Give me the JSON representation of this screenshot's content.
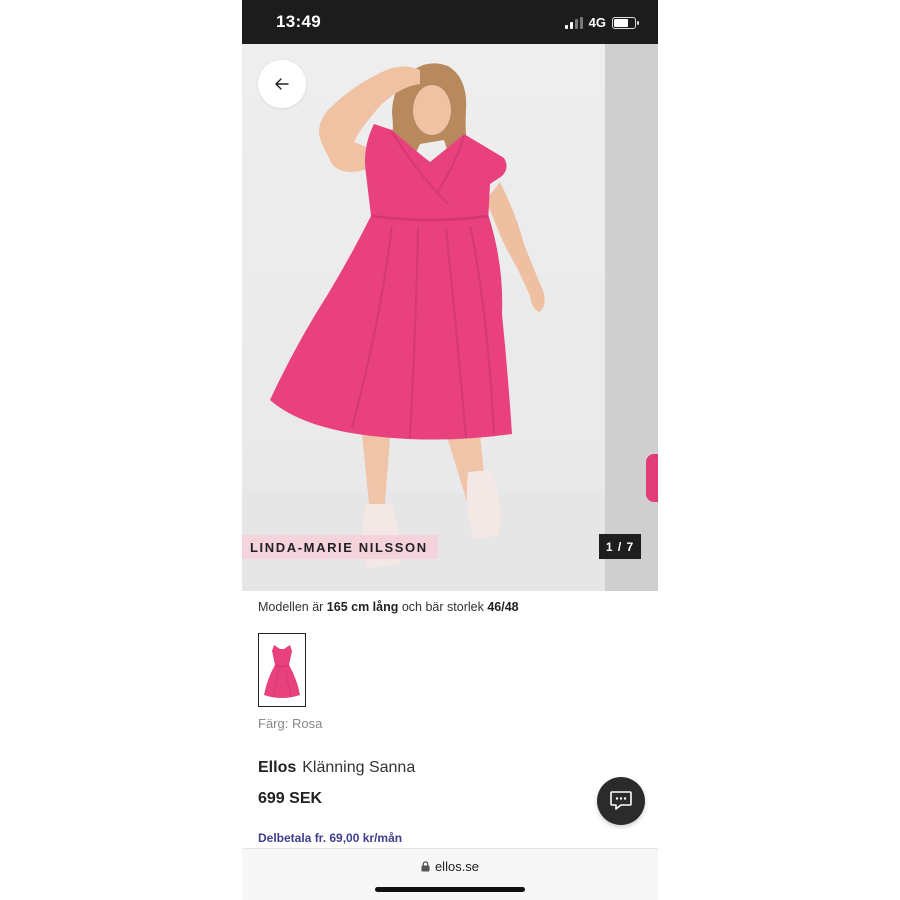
{
  "status_bar": {
    "time": "13:49",
    "network": "4G",
    "signal_bars_active": 2,
    "signal_bars_total": 4,
    "battery_level": 0.75
  },
  "gallery": {
    "model_name_tag": "LINDA-MARIE NILSSON",
    "counter": "1 / 7",
    "back_icon": "arrow-left-icon",
    "image_subject": "woman in pink dress"
  },
  "model_info": {
    "prefix": "Modellen är ",
    "height": "165 cm lång",
    "middle": " och bär storlek ",
    "size": "46/48"
  },
  "color": {
    "label": "Färg: Rosa",
    "swatch_color": "#e8417e"
  },
  "product": {
    "brand": "Ellos",
    "name": "Klänning Sanna",
    "price": "699 SEK",
    "installment": "Delbetala fr. 69,00 kr/mån"
  },
  "chat": {
    "icon": "chat-bubble-icon"
  },
  "browser": {
    "url": "ellos.se",
    "lock_icon": "lock-icon"
  },
  "colors": {
    "dress": "#e8417e",
    "tag_background": "#f4d3dc",
    "installment_text": "#3f3f8f"
  }
}
